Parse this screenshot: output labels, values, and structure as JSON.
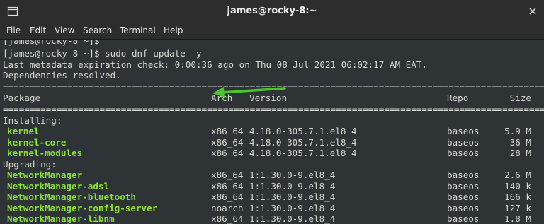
{
  "window": {
    "title": "james@rocky-8:~"
  },
  "icons": {
    "new_tab": "new-tab-icon",
    "close": "close-icon"
  },
  "menu": [
    "File",
    "Edit",
    "View",
    "Search",
    "Terminal",
    "Help"
  ],
  "colors": {
    "background": "#2e3436",
    "text": "#d3d7cf",
    "package": "#8ae234",
    "arrow": "#4cc42b"
  },
  "terminal": {
    "line_partial": "[james@rocky-8 ~]$",
    "command_line": "[james@rocky-8 ~]$ sudo dnf update -y",
    "metadata": "Last metadata expiration check: 0:00:36 ago on Thu 08 Jul 2021 06:02:17 AM EAT.",
    "deps": "Dependencies resolved.",
    "separator": "================================================================================================================",
    "header": {
      "package": "Package",
      "arch": "Arch",
      "version": "Version",
      "repo": "Repo",
      "size": "Size"
    },
    "installing": "Installing:",
    "upgrading": "Upgrading:",
    "installing_rows": [
      {
        "name": "kernel",
        "arch": "x86_64",
        "version": "4.18.0-305.7.1.el8_4",
        "repo": "baseos",
        "size": "5.9 M"
      },
      {
        "name": "kernel-core",
        "arch": "x86_64",
        "version": "4.18.0-305.7.1.el8_4",
        "repo": "baseos",
        "size": "36 M"
      },
      {
        "name": "kernel-modules",
        "arch": "x86_64",
        "version": "4.18.0-305.7.1.el8_4",
        "repo": "baseos",
        "size": "28 M"
      }
    ],
    "upgrading_rows": [
      {
        "name": "NetworkManager",
        "arch": "x86_64",
        "version": "1:1.30.0-9.el8_4",
        "repo": "baseos",
        "size": "2.6 M"
      },
      {
        "name": "NetworkManager-adsl",
        "arch": "x86_64",
        "version": "1:1.30.0-9.el8_4",
        "repo": "baseos",
        "size": "140 k"
      },
      {
        "name": "NetworkManager-bluetooth",
        "arch": "x86_64",
        "version": "1:1.30.0-9.el8_4",
        "repo": "baseos",
        "size": "166 k"
      },
      {
        "name": "NetworkManager-config-server",
        "arch": "noarch",
        "version": "1:1.30.0-9.el8_4",
        "repo": "baseos",
        "size": "127 k"
      },
      {
        "name": "NetworkManager-libnm",
        "arch": "x86_64",
        "version": "1:1.30.0-9.el8_4",
        "repo": "baseos",
        "size": "1.8 M"
      }
    ]
  }
}
